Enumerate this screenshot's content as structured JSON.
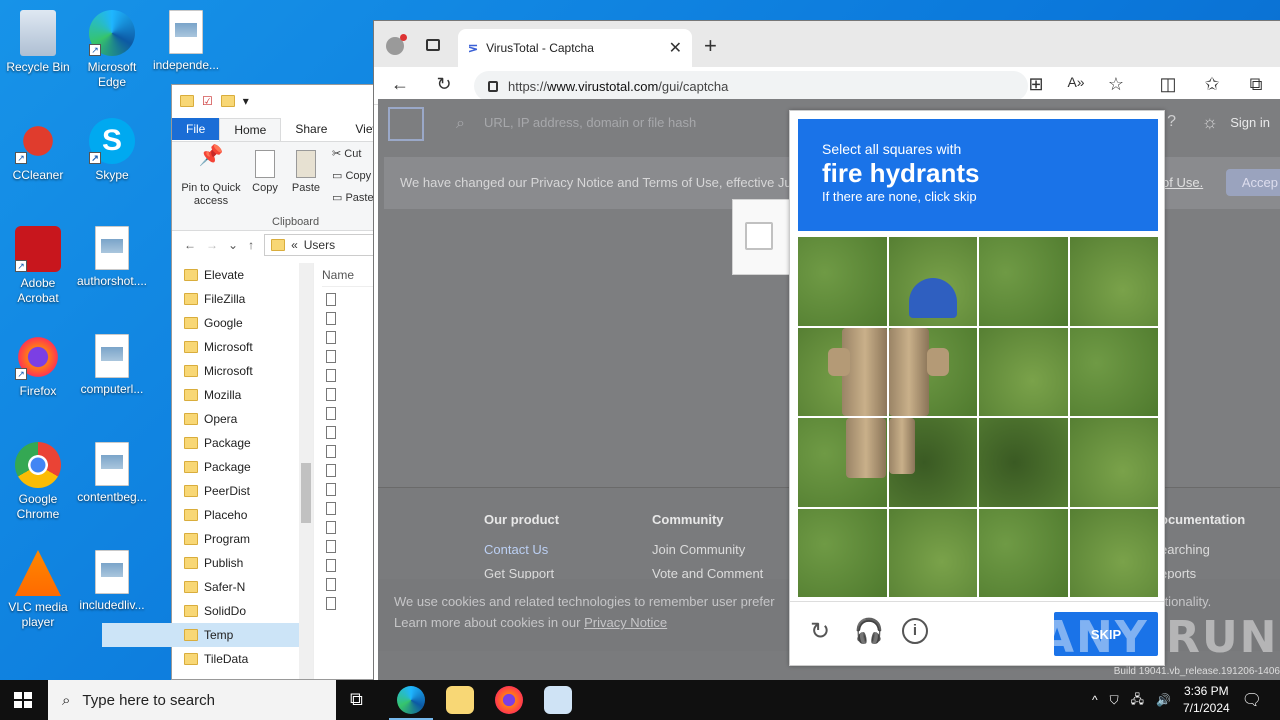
{
  "desktop": {
    "icons": [
      {
        "label": "Recycle Bin"
      },
      {
        "label": "Microsoft Edge"
      },
      {
        "label": "independe..."
      },
      {
        "label": "CCleaner"
      },
      {
        "label": "Skype"
      },
      {
        "label": "Adobe Acrobat"
      },
      {
        "label": "authorshot...."
      },
      {
        "label": "Firefox"
      },
      {
        "label": "computerl..."
      },
      {
        "label": "Google Chrome"
      },
      {
        "label": "contentbeg..."
      },
      {
        "label": "VLC media player"
      },
      {
        "label": "includedliv..."
      }
    ]
  },
  "explorer": {
    "tabs": [
      "File",
      "Home",
      "Share",
      "View"
    ],
    "ribbon": {
      "pin_label": "Pin to Quick access",
      "copy_label": "Copy",
      "paste_label": "Paste",
      "cut_label": "Cut",
      "copy_path_label": "Copy",
      "paste_shortcut_label": "Paste",
      "group_label": "Clipboard"
    },
    "breadcrumb": [
      "Users"
    ],
    "column_header": "Name",
    "tree": [
      "Elevate",
      "FileZilla",
      "Google",
      "Microsoft",
      "Microsoft",
      "Mozilla",
      "Opera",
      "Package",
      "Package",
      "PeerDist",
      "Placeho",
      "Program",
      "Publish",
      "Safer-N",
      "SolidDo",
      "Temp",
      "TileData"
    ],
    "selected_tree_item": "Temp"
  },
  "browser": {
    "tab_title": "VirusTotal - Captcha",
    "url_prefix": "https://",
    "url_domain": "www.virustotal.com",
    "url_path": "/gui/captcha",
    "page": {
      "search_placeholder": "URL, IP address, domain or file hash",
      "sign_in": "Sign in",
      "notice": "We have changed our Privacy Notice and Terms of Use, effective Ju",
      "notice_tail": "of Use.",
      "accept": "Accep",
      "footer": {
        "product_heading": "Our product",
        "product_links": [
          "Contact Us",
          "Get Support"
        ],
        "community_heading": "Community",
        "community_links": [
          "Join Community",
          "Vote and Comment"
        ],
        "docs_heading": "ocumentation",
        "docs_links": [
          "earching",
          "eports"
        ]
      },
      "cookie_line1": "We use cookies and related technologies to remember user prefer",
      "cookie_line1_tail": "functionality.",
      "cookie_line2": "Learn more about cookies in our",
      "cookie_link": "Privacy Notice"
    }
  },
  "captcha": {
    "instruction": "Select all squares with",
    "target": "fire hydrants",
    "subtext": "If there are none, click skip",
    "skip_label": "SKIP",
    "colors": {
      "header": "#1a73e8",
      "button": "#1a73e8"
    }
  },
  "watermark": "ANY RUN",
  "taskbar": {
    "search_placeholder": "Type here to search",
    "time": "3:36 PM",
    "date": "7/1/2024",
    "build": "Build 19041.vb_release.191206-1406"
  }
}
